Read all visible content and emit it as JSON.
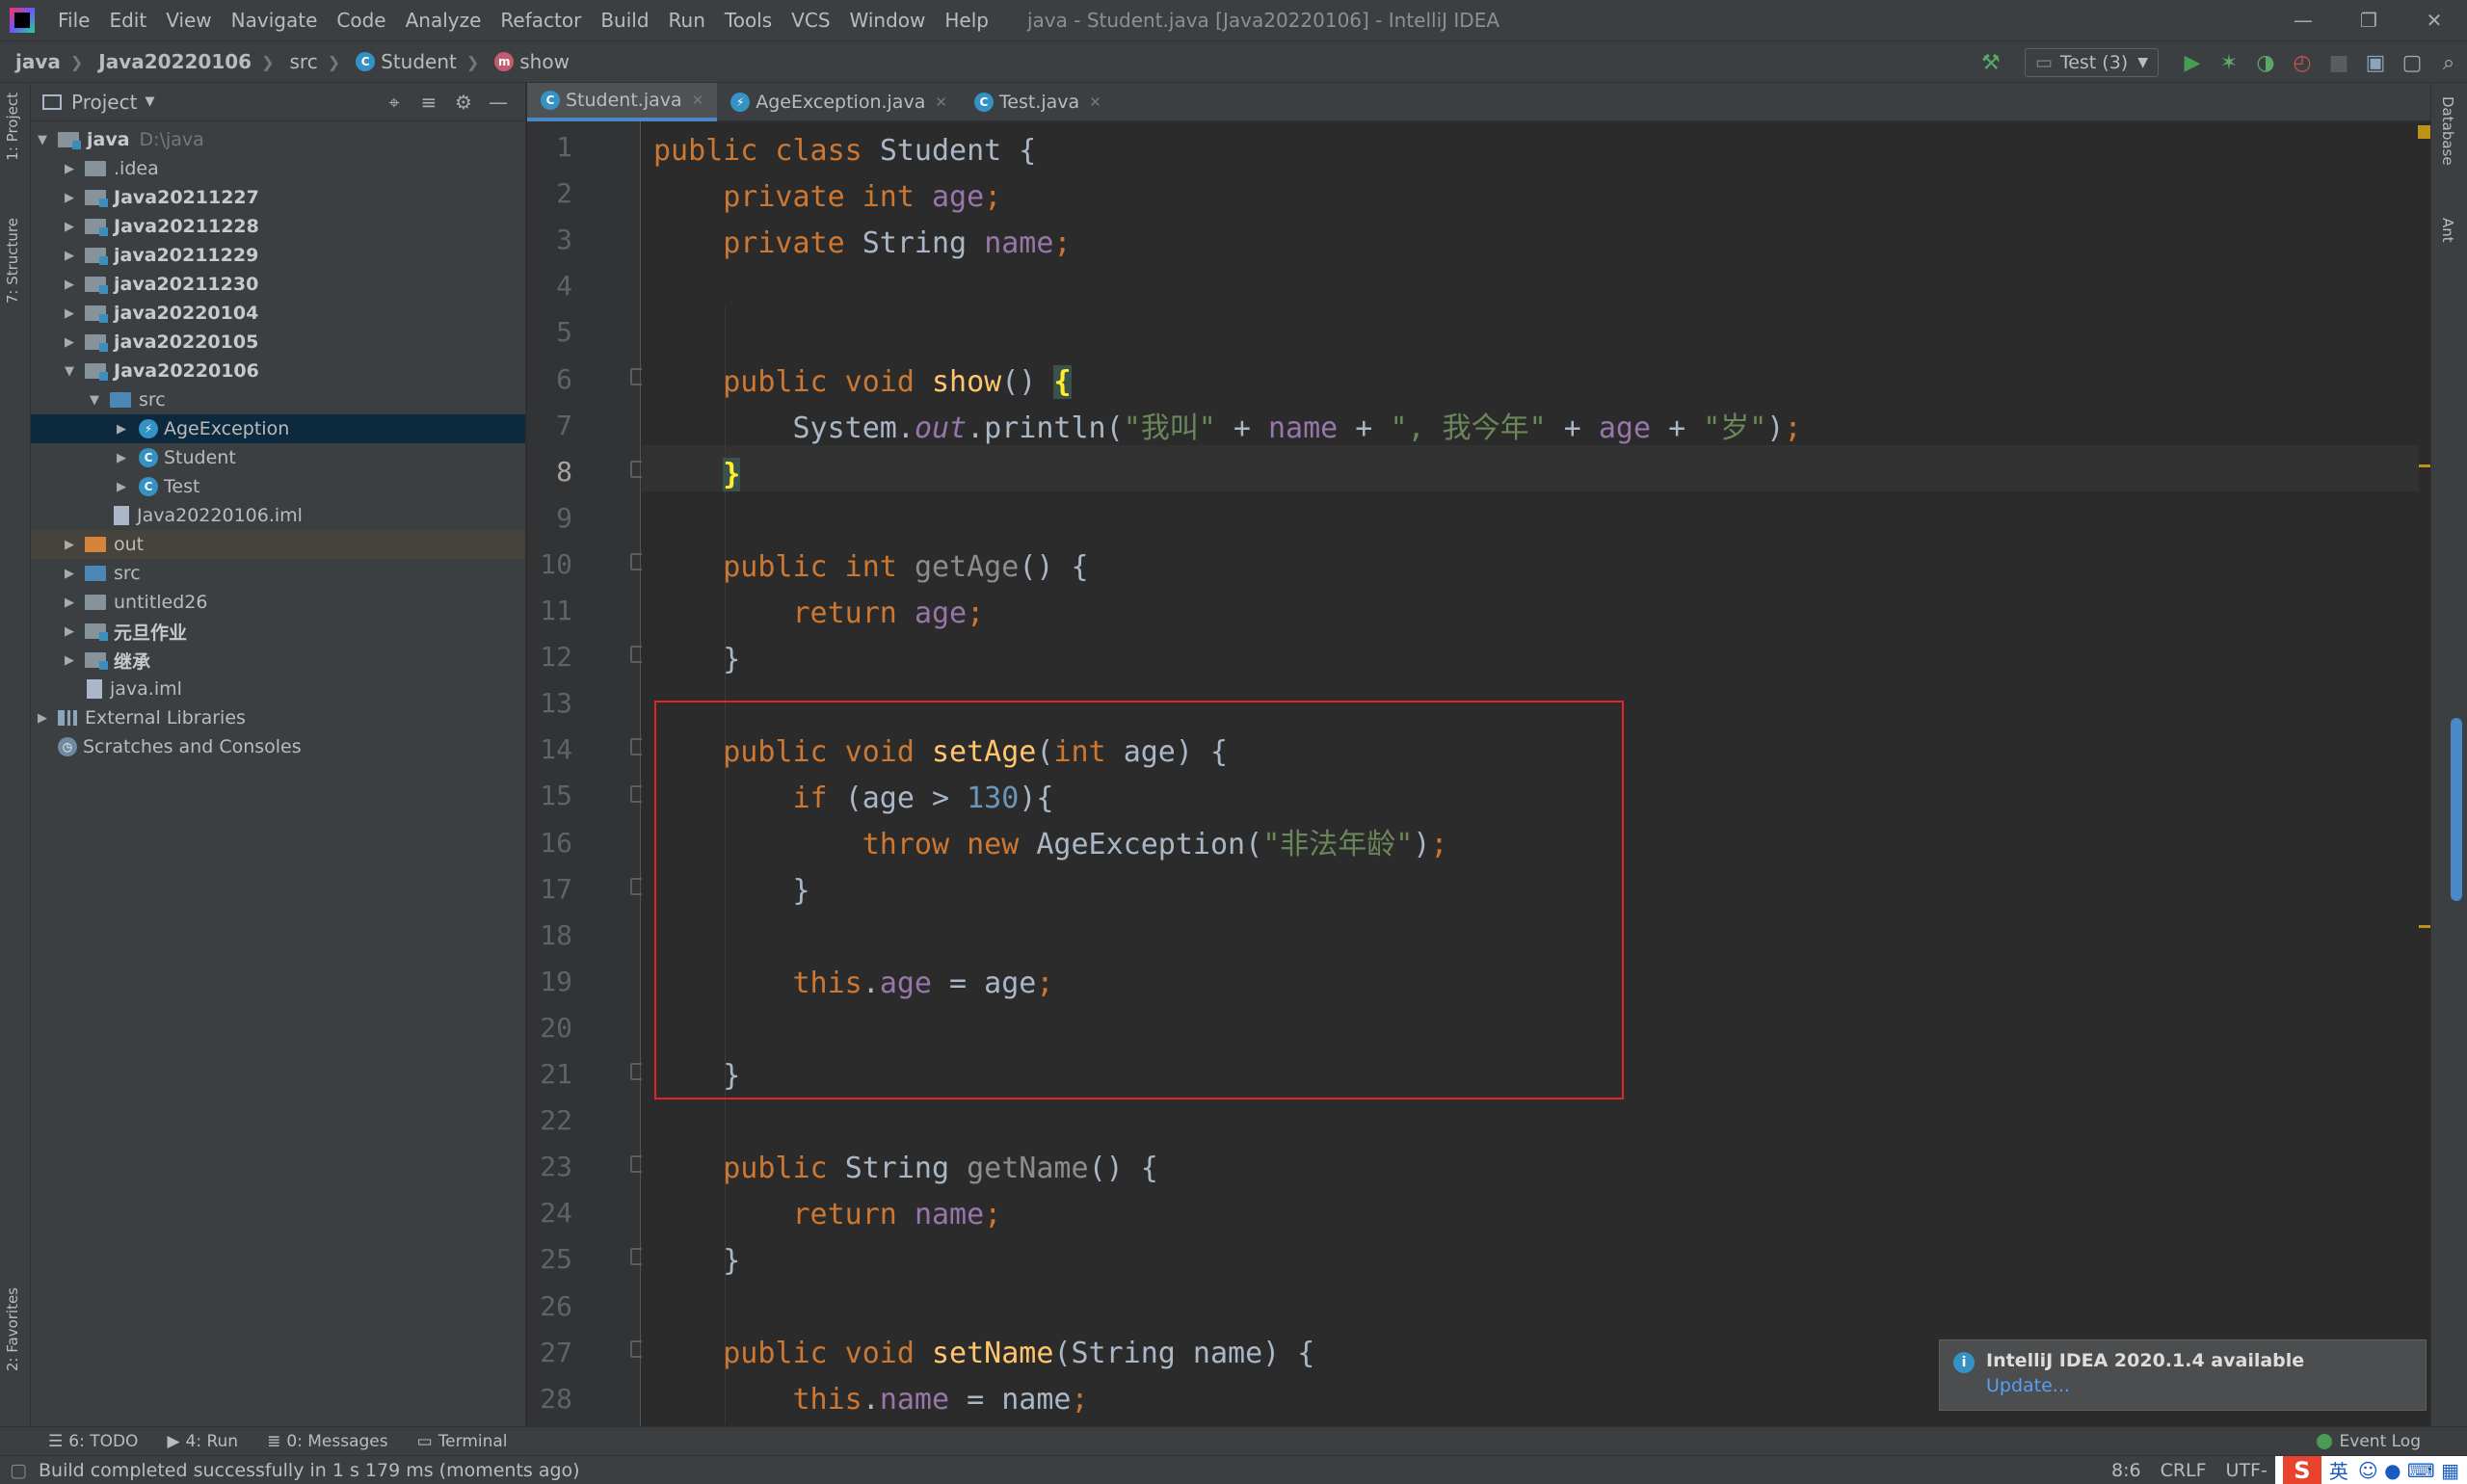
{
  "menubar": {
    "items": [
      "File",
      "Edit",
      "View",
      "Navigate",
      "Code",
      "Analyze",
      "Refactor",
      "Build",
      "Run",
      "Tools",
      "VCS",
      "Window",
      "Help"
    ],
    "window_title": "java - Student.java [Java20220106] - IntelliJ IDEA"
  },
  "breadcrumb": {
    "project": "java",
    "module": "Java20220106",
    "folder": "src",
    "class": "Student",
    "method": "show"
  },
  "toolbar": {
    "run_config": "Test (3)"
  },
  "left_stripe": {
    "project_tab": "1: Project",
    "structure_tab": "7: Structure",
    "favorites_tab": "2: Favorites"
  },
  "right_stripe": {
    "database_tab": "Database",
    "ant_tab": "Ant"
  },
  "project_panel": {
    "title": "Project",
    "tree": [
      {
        "label": "java",
        "hint": "D:\\java",
        "bold": true
      },
      {
        "label": ".idea"
      },
      {
        "label": "Java20211227",
        "bold": true
      },
      {
        "label": "Java20211228",
        "bold": true
      },
      {
        "label": "java20211229",
        "bold": true
      },
      {
        "label": "java20211230",
        "bold": true
      },
      {
        "label": "java20220104",
        "bold": true
      },
      {
        "label": "java20220105",
        "bold": true
      },
      {
        "label": "Java20220106",
        "bold": true
      },
      {
        "label": "src"
      },
      {
        "label": "AgeException"
      },
      {
        "label": "Student"
      },
      {
        "label": "Test"
      },
      {
        "label": "Java20220106.iml"
      },
      {
        "label": "out"
      },
      {
        "label": "src"
      },
      {
        "label": "untitled26"
      },
      {
        "label": "元旦作业",
        "bold": true
      },
      {
        "label": "继承",
        "bold": true
      },
      {
        "label": "java.iml"
      },
      {
        "label": "External Libraries"
      },
      {
        "label": "Scratches and Consoles"
      }
    ]
  },
  "editor_tabs": [
    "Student.java",
    "AgeException.java",
    "Test.java"
  ],
  "editor": {
    "line_numbers": [
      "1",
      "2",
      "3",
      "4",
      "5",
      "6",
      "7",
      "8",
      "9",
      "10",
      "11",
      "12",
      "13",
      "14",
      "15",
      "16",
      "17",
      "18",
      "19",
      "20",
      "21",
      "22",
      "23",
      "24",
      "25",
      "26",
      "27",
      "28"
    ],
    "current_line": 8,
    "code": {
      "l1_kw": "public class ",
      "l1_rest": "Student {",
      "l2_kw": "private int ",
      "l2_fld": "age",
      "l2_end": ";",
      "l3_kw": "private ",
      "l3_type": "String ",
      "l3_fld": "name",
      "l3_end": ";",
      "l6_kw": "public void ",
      "l6_fn": "show",
      "l6_paren": "() ",
      "l6_brace": "{",
      "l7_a": "System.",
      "l7_out": "out",
      "l7_b": ".println(",
      "l7_s1": "\"我叫\"",
      "l7_c": " + ",
      "l7_name": "name",
      "l7_d": " + ",
      "l7_s2": "\", 我今年\"",
      "l7_e": " + ",
      "l7_age": "age",
      "l7_f": " + ",
      "l7_s3": "\"岁\"",
      "l7_g": ")",
      "l7_semi": ";",
      "l8_brace": "}",
      "l10_kw": "public int ",
      "l10_fn": "getAge",
      "l10_rest": "() {",
      "l11_kw": "return ",
      "l11_fld": "age",
      "l11_end": ";",
      "l12": "}",
      "l14_kw": "public void ",
      "l14_fn": "setAge",
      "l14_a": "(",
      "l14_kw2": "int ",
      "l14_b": "age) {",
      "l15_kw": "if ",
      "l15_a": "(age > ",
      "l15_num": "130",
      "l15_b": "){",
      "l16_kw": "throw new ",
      "l16_a": "AgeException(",
      "l16_str": "\"非法年龄\"",
      "l16_b": ")",
      "l16_semi": ";",
      "l17": "}",
      "l19_kw": "this",
      "l19_a": ".",
      "l19_fld": "age",
      "l19_b": " = age",
      "l19_semi": ";",
      "l21": "}",
      "l23_kw": "public ",
      "l23_type": "String ",
      "l23_fn": "getName",
      "l23_rest": "() {",
      "l24_kw": "return ",
      "l24_fld": "name",
      "l24_end": ";",
      "l25": "}",
      "l27_kw": "public void ",
      "l27_fn": "setName",
      "l27_rest": "(String name) {",
      "l28_kw": "this",
      "l28_a": ".",
      "l28_fld": "name",
      "l28_b": " = name",
      "l28_semi": ";"
    }
  },
  "notification": {
    "title": "IntelliJ IDEA 2020.1.4 available",
    "link": "Update..."
  },
  "bottom_tabs": [
    "6: TODO",
    "4: Run",
    "0: Messages",
    "Terminal"
  ],
  "event_log": "Event Log",
  "statusbar": {
    "message": "Build completed successfully in 1 s 179 ms (moments ago)",
    "position": "8:6",
    "line_sep": "CRLF",
    "encoding": "UTF-",
    "ime_lang": "英"
  },
  "colors": {
    "keyword": "#cc7832",
    "field": "#9876aa",
    "method": "#ffc66d",
    "string": "#6a8759",
    "number": "#6897bb",
    "highlight_box": "#e0252b",
    "accent": "#4a88c7"
  }
}
